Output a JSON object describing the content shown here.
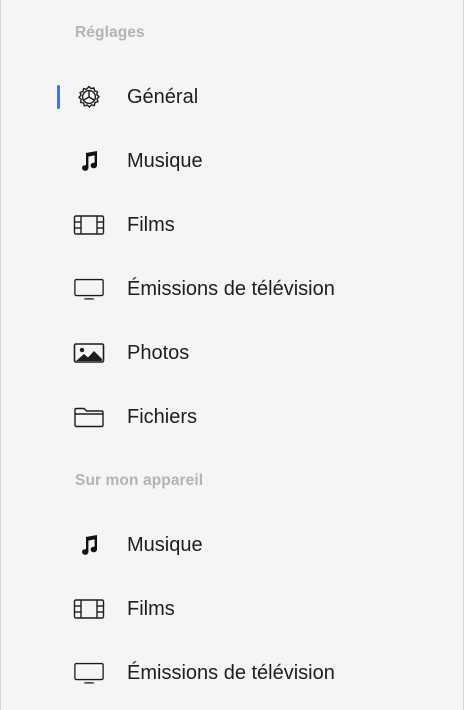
{
  "sections": [
    {
      "header": "Réglages",
      "items": [
        {
          "label": "Général",
          "icon": "gear-icon",
          "selected": true
        },
        {
          "label": "Musique",
          "icon": "music-note-icon",
          "selected": false
        },
        {
          "label": "Films",
          "icon": "film-icon",
          "selected": false
        },
        {
          "label": "Émissions de télévision",
          "icon": "tv-icon",
          "selected": false
        },
        {
          "label": "Photos",
          "icon": "photo-icon",
          "selected": false
        },
        {
          "label": "Fichiers",
          "icon": "folder-icon",
          "selected": false
        }
      ]
    },
    {
      "header": "Sur mon appareil",
      "items": [
        {
          "label": "Musique",
          "icon": "music-note-icon",
          "selected": false
        },
        {
          "label": "Films",
          "icon": "film-icon",
          "selected": false
        },
        {
          "label": "Émissions de télévision",
          "icon": "tv-icon",
          "selected": false
        }
      ]
    }
  ],
  "colors": {
    "accent": "#3478f6",
    "header_text": "#b3b3b3",
    "item_text": "#1d1d1f",
    "background": "#f5f5f5"
  }
}
